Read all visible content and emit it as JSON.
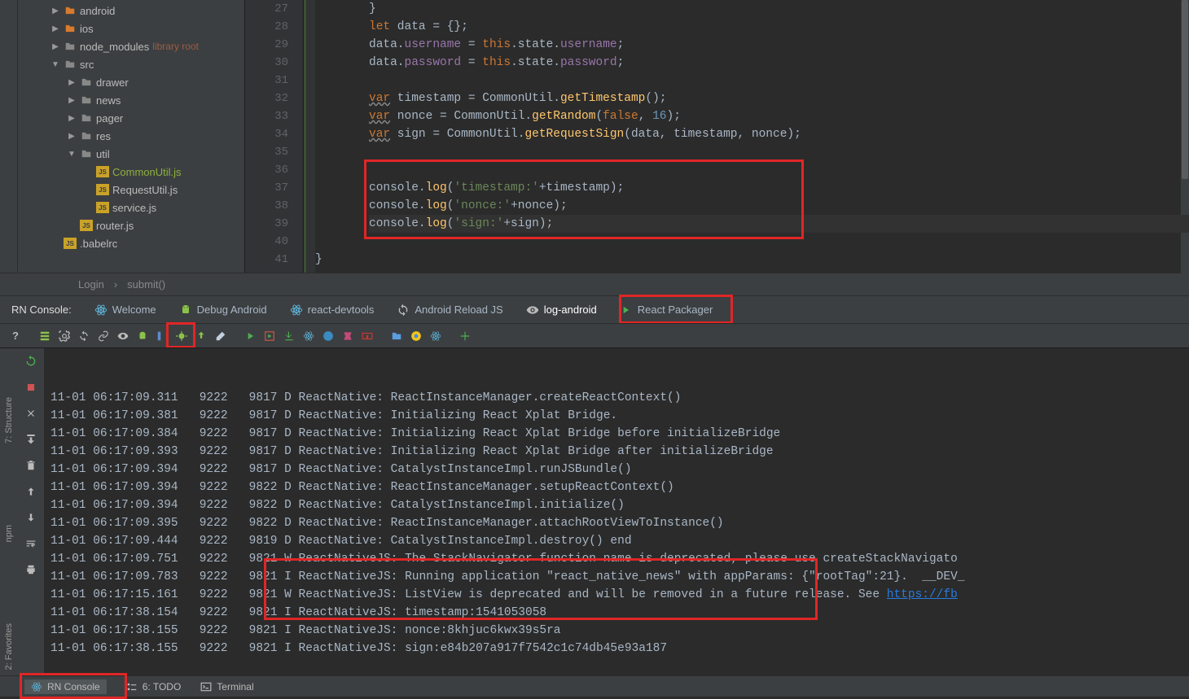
{
  "project_tree": [
    {
      "indent": 40,
      "arrow": "▶",
      "icon": "folder-orange",
      "label": "android"
    },
    {
      "indent": 40,
      "arrow": "▶",
      "icon": "folder-orange",
      "label": "ios"
    },
    {
      "indent": 40,
      "arrow": "▶",
      "icon": "folder-grey",
      "label": "node_modules",
      "extra": "library root"
    },
    {
      "indent": 40,
      "arrow": "▼",
      "icon": "folder-grey",
      "label": "src"
    },
    {
      "indent": 60,
      "arrow": "▶",
      "icon": "folder-grey",
      "label": "drawer"
    },
    {
      "indent": 60,
      "arrow": "▶",
      "icon": "folder-grey",
      "label": "news"
    },
    {
      "indent": 60,
      "arrow": "▶",
      "icon": "folder-grey",
      "label": "pager"
    },
    {
      "indent": 60,
      "arrow": "▶",
      "icon": "folder-grey",
      "label": "res"
    },
    {
      "indent": 60,
      "arrow": "▼",
      "icon": "folder-grey",
      "label": "util"
    },
    {
      "indent": 80,
      "arrow": "",
      "icon": "js",
      "label": "CommonUtil.js",
      "highlight": true
    },
    {
      "indent": 80,
      "arrow": "",
      "icon": "js",
      "label": "RequestUtil.js"
    },
    {
      "indent": 80,
      "arrow": "",
      "icon": "js",
      "label": "service.js"
    },
    {
      "indent": 60,
      "arrow": "",
      "icon": "js",
      "label": "router.js"
    },
    {
      "indent": 40,
      "arrow": "",
      "icon": "js",
      "label": ".babelrc"
    }
  ],
  "line_numbers": [
    "27",
    "28",
    "29",
    "30",
    "31",
    "32",
    "33",
    "34",
    "35",
    "36",
    "37",
    "38",
    "39",
    "40",
    "41"
  ],
  "code": {
    "l27": "}",
    "l28": {
      "kw": "let",
      "rest": " data = {};"
    },
    "l29": {
      "p1": "data.",
      "prop1": "username",
      "p2": " = ",
      "this": "this",
      "p3": ".state.",
      "prop2": "username",
      "p4": ";"
    },
    "l30": {
      "p1": "data.",
      "prop1": "password",
      "p2": " = ",
      "this": "this",
      "p3": ".state.",
      "prop2": "password",
      "p4": ";"
    },
    "l32": {
      "kw": "var",
      "p1": " timestamp = CommonUtil.",
      "fn": "getTimestamp",
      "p2": "();"
    },
    "l33": {
      "kw": "var",
      "p1": " nonce = CommonUtil.",
      "fn": "getRandom",
      "p2": "(",
      "bool": "false",
      "p3": ", ",
      "num": "16",
      "p4": ");"
    },
    "l34": {
      "kw": "var",
      "p1": " sign = CommonUtil.",
      "fn": "getRequestSign",
      "p2": "(data, timestamp, nonce);"
    },
    "l37": {
      "p1": "console.",
      "fn": "log",
      "p2": "(",
      "str": "'timestamp:'",
      "p3": "+timestamp);"
    },
    "l38": {
      "p1": "console.",
      "fn": "log",
      "p2": "(",
      "str": "'nonce:'",
      "p3": "+nonce);"
    },
    "l39": {
      "p1": "console.",
      "fn": "log",
      "p2": "(",
      "str": "'sign:'",
      "p3": "+sign);"
    },
    "l41": "}"
  },
  "breadcrumb": {
    "item1": "Login",
    "sep": "›",
    "item2": "submit()"
  },
  "tabs": {
    "title": "RN Console:",
    "welcome": "Welcome",
    "debug": "Debug Android",
    "devtools": "react-devtools",
    "reload": "Android Reload JS",
    "logandroid": "log-android",
    "packager": "React Packager"
  },
  "side_tabs": {
    "structure": "7: Structure",
    "npm": "npm",
    "favorites": "2: Favorites"
  },
  "console_log": [
    "11-01 06:17:09.311   9222   9817 D ReactNative: ReactInstanceManager.createReactContext()",
    "11-01 06:17:09.381   9222   9817 D ReactNative: Initializing React Xplat Bridge.",
    "11-01 06:17:09.384   9222   9817 D ReactNative: Initializing React Xplat Bridge before initializeBridge",
    "11-01 06:17:09.393   9222   9817 D ReactNative: Initializing React Xplat Bridge after initializeBridge",
    "11-01 06:17:09.394   9222   9817 D ReactNative: CatalystInstanceImpl.runJSBundle()",
    "11-01 06:17:09.394   9222   9822 D ReactNative: ReactInstanceManager.setupReactContext()",
    "11-01 06:17:09.394   9222   9822 D ReactNative: CatalystInstanceImpl.initialize()",
    "11-01 06:17:09.395   9222   9822 D ReactNative: ReactInstanceManager.attachRootViewToInstance()",
    "11-01 06:17:09.444   9222   9819 D ReactNative: CatalystInstanceImpl.destroy() end",
    "11-01 06:17:09.751   9222   9821 W ReactNativeJS: The StackNavigator function name is deprecated, please use createStackNavigato",
    "11-01 06:17:09.783   9222   9821 I ReactNativeJS: Running application \"react_native_news\" with appParams: {\"rootTag\":21}.  __DEV_",
    "11-01 06:17:15.161   9222   9821 W ReactNativeJS: ListView is deprecated and will be removed in a future release. See ",
    "11-01 06:17:38.154   9222   9821 I ReactNativeJS: timestamp:1541053058",
    "11-01 06:17:38.155   9222   9821 I ReactNativeJS: nonce:8khjuc6kwx39s5ra",
    "11-01 06:17:38.155   9222   9821 I ReactNativeJS: sign:e84b207a917f7542c1c74db45e93a187"
  ],
  "log_link": "https://fb",
  "bottom": {
    "rnconsole": "RN Console",
    "todo": "6: TODO",
    "terminal": "Terminal"
  }
}
